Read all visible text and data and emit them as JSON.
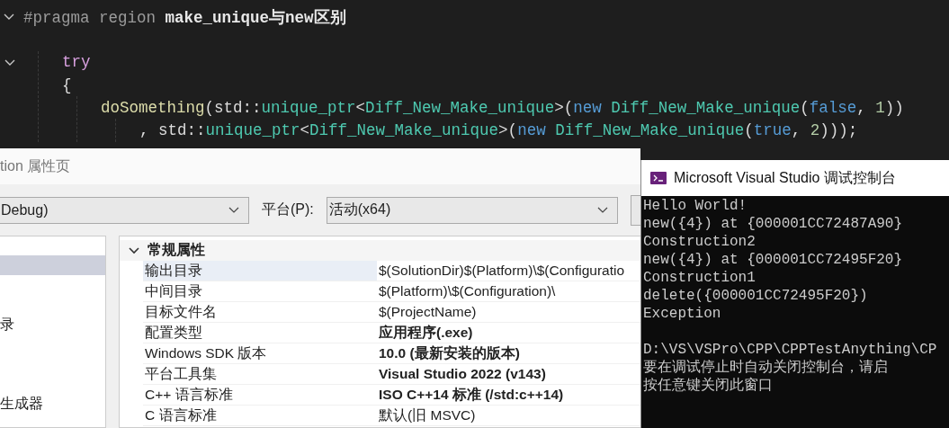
{
  "editor": {
    "lines": [
      {
        "fold": true,
        "tokens": [
          {
            "text": "#pragma",
            "kind": "directive"
          },
          {
            "text": " region ",
            "kind": "directive"
          },
          {
            "text": "make_unique与new区别",
            "kind": "region"
          }
        ],
        "children": [
          {
            "fold": true,
            "gap": true,
            "tokens": [
              {
                "text": "try",
                "kind": "control"
              }
            ]
          },
          {
            "fold": false,
            "gap": false,
            "tokens": [
              {
                "text": "{",
                "kind": "plain"
              }
            ],
            "children": [
              {
                "fold": false,
                "gap": false,
                "tokens": [
                  {
                    "text": "doSomething",
                    "kind": "function"
                  },
                  {
                    "text": "(std::",
                    "kind": "plain"
                  },
                  {
                    "text": "unique_ptr",
                    "kind": "type"
                  },
                  {
                    "text": "<",
                    "kind": "plain"
                  },
                  {
                    "text": "Diff_New_Make_unique",
                    "kind": "type"
                  },
                  {
                    "text": ">(",
                    "kind": "plain"
                  },
                  {
                    "text": "new",
                    "kind": "keyword"
                  },
                  {
                    "text": " Diff_New_Make_unique",
                    "kind": "type"
                  },
                  {
                    "text": "(",
                    "kind": "plain"
                  },
                  {
                    "text": "false",
                    "kind": "keyword"
                  },
                  {
                    "text": ", ",
                    "kind": "plain"
                  },
                  {
                    "text": "1",
                    "kind": "number"
                  },
                  {
                    "text": "))",
                    "kind": "plain"
                  }
                ],
                "children": [
                  {
                    "fold": false,
                    "gap": false,
                    "tokens": [
                      {
                        "text": ", std::",
                        "kind": "plain"
                      },
                      {
                        "text": "unique_ptr",
                        "kind": "type"
                      },
                      {
                        "text": "<",
                        "kind": "plain"
                      },
                      {
                        "text": "Diff_New_Make_unique",
                        "kind": "type"
                      },
                      {
                        "text": ">(",
                        "kind": "plain"
                      },
                      {
                        "text": "new",
                        "kind": "keyword"
                      },
                      {
                        "text": " Diff_New_Make_unique",
                        "kind": "type"
                      },
                      {
                        "text": "(",
                        "kind": "plain"
                      },
                      {
                        "text": "true",
                        "kind": "keyword"
                      },
                      {
                        "text": ", ",
                        "kind": "plain"
                      },
                      {
                        "text": "2",
                        "kind": "number"
                      },
                      {
                        "text": ")));",
                        "kind": "plain"
                      }
                    ]
                  }
                ]
              }
            ]
          }
        ]
      }
    ]
  },
  "dialog": {
    "title": "tion 属性页",
    "configuration": {
      "value": "Debug)"
    },
    "platform": {
      "label": "平台(P):",
      "value": "活动(x64)"
    },
    "tree": [
      {
        "selected": true
      },
      {
        "selected": false
      },
      {
        "selected": false
      },
      {
        "label": "录",
        "selected": false
      },
      {
        "selected": false
      },
      {
        "selected": false
      },
      {
        "selected": false
      },
      {
        "label": "生成器",
        "selected": false
      }
    ],
    "grid": {
      "group": {
        "label": "常规属性",
        "expanded": true
      },
      "rows": [
        {
          "name": "输出目录",
          "value": "$(SolutionDir)$(Platform)\\$(Configuratio",
          "bold": false,
          "selected": true
        },
        {
          "name": "中间目录",
          "value": "$(Platform)\\$(Configuration)\\",
          "bold": false,
          "selected": false
        },
        {
          "name": "目标文件名",
          "value": "$(ProjectName)",
          "bold": false,
          "selected": false
        },
        {
          "name": "配置类型",
          "value": "应用程序(.exe)",
          "bold": true,
          "selected": false
        },
        {
          "name": "Windows SDK 版本",
          "value": "10.0 (最新安装的版本)",
          "bold": true,
          "selected": false
        },
        {
          "name": "平台工具集",
          "value": "Visual Studio 2022 (v143)",
          "bold": true,
          "selected": false
        },
        {
          "name": "C++ 语言标准",
          "value": "ISO C++14 标准 (/std:c++14)",
          "bold": true,
          "selected": false
        },
        {
          "name": "C 语言标准",
          "value": "默认(旧 MSVC)",
          "bold": false,
          "selected": false
        }
      ]
    }
  },
  "console": {
    "title": "Microsoft Visual Studio 调试控制台",
    "blocks": [
      [
        "Hello World!",
        "new({4}) at {000001CC72487A90}",
        "Construction2",
        "new({4}) at {000001CC72495F20}",
        "Construction1",
        "delete({000001CC72495F20})",
        "Exception"
      ],
      [
        "D:\\VS\\VSPro\\CPP\\CPPTestAnything\\CP",
        "要在调试停止时自动关闭控制台，请启",
        "按任意键关闭此窗口"
      ]
    ]
  }
}
